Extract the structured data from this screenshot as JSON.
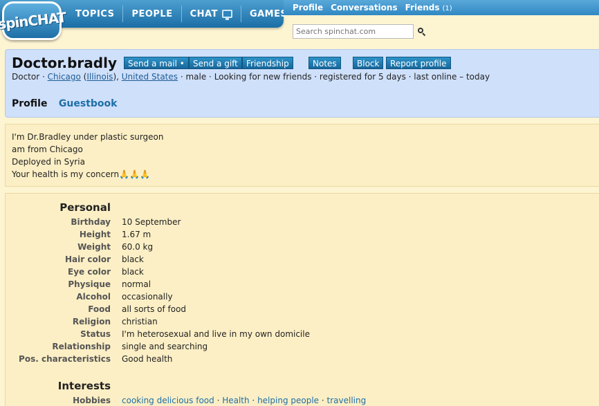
{
  "brand": {
    "logo_text": "spinCHAT"
  },
  "nav": {
    "main": [
      "TOPICS",
      "PEOPLE",
      "CHAT",
      "GAMES"
    ],
    "sub": [
      {
        "label": "Profile",
        "count": ""
      },
      {
        "label": "Conversations",
        "count": ""
      },
      {
        "label": "Friends",
        "count": "(1)"
      }
    ]
  },
  "search": {
    "placeholder": "Search spinchat.com"
  },
  "profile": {
    "username": "Doctor.bradly",
    "actions": [
      "Send a mail •",
      "Send a gift",
      "Friendship",
      "Notes",
      "Block",
      "Report profile"
    ],
    "info": {
      "occupation": "Doctor",
      "city": "Chicago",
      "state": "Illinois",
      "country": "United States",
      "gender": "male",
      "looking_for": "Looking for new friends",
      "registered": "registered for 5 days",
      "last_online": "last online – today"
    },
    "tabs": [
      "Profile",
      "Guestbook"
    ]
  },
  "about": {
    "lines": [
      "I'm Dr.Bradley under plastic surgeon",
      "am from Chicago",
      "Deployed in Syria",
      "Your health is my concern"
    ],
    "emoji": "🙏🙏🙏"
  },
  "personal": {
    "title": "Personal",
    "fields": [
      {
        "label": "Birthday",
        "value": "10 September"
      },
      {
        "label": "Height",
        "value": "1.67 m"
      },
      {
        "label": "Weight",
        "value": "60.0 kg"
      },
      {
        "label": "Hair color",
        "value": "black"
      },
      {
        "label": "Eye color",
        "value": "black"
      },
      {
        "label": "Physique",
        "value": "normal"
      },
      {
        "label": "Alcohol",
        "value": "occasionally"
      },
      {
        "label": "Food",
        "value": "all sorts of food"
      },
      {
        "label": "Religion",
        "value": "christian"
      },
      {
        "label": "Status",
        "value": "I'm heterosexual and live in my own domicile"
      },
      {
        "label": "Relationship",
        "value": "single and searching"
      },
      {
        "label": "Pos. characteristics",
        "value": "Good health"
      }
    ]
  },
  "interests": {
    "title": "Interests",
    "hobbies_label": "Hobbies",
    "hobbies": [
      "cooking delicious food",
      "Health",
      "helping people",
      "travelling"
    ]
  },
  "colors": {
    "nav_blue": "#1b6ea5",
    "button_blue": "#2e93c9",
    "page_bg": "#fdf4d2",
    "header_bg": "#cfe0fb",
    "link": "#1d5c94"
  }
}
